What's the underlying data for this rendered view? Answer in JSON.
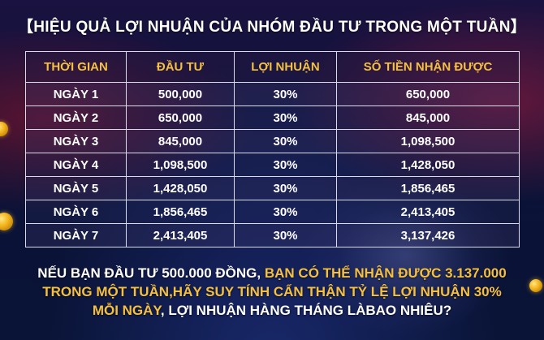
{
  "title": "【HIỆU QUẢ LỢI NHUẬN CỦA NHÓM ĐẦU TƯ TRONG MỘT TUẦN】",
  "table": {
    "headers": [
      "THỜI GIAN",
      "ĐẦU TƯ",
      "LỢI NHUẬN",
      "SỐ TIỀN NHẬN ĐƯỢC"
    ],
    "rows": [
      [
        "NGÀY 1",
        "500,000",
        "30%",
        "650,000"
      ],
      [
        "NGÀY 2",
        "650,000",
        "30%",
        "845,000"
      ],
      [
        "NGÀY 3",
        "845,000",
        "30%",
        "1,098,500"
      ],
      [
        "NGÀY 4",
        "1,098,500",
        "30%",
        "1,428,050"
      ],
      [
        "NGÀY 5",
        "1,428,050",
        "30%",
        "1,856,465"
      ],
      [
        "NGÀY 6",
        "1,856,465",
        "30%",
        "2,413,405"
      ],
      [
        "NGÀY 7",
        "2,413,405",
        "30%",
        "3,137,426"
      ]
    ]
  },
  "footer": {
    "line1_white": "NẾU BẠN ĐẦU TƯ 500.000 ĐỒNG, ",
    "line1_gold": "BẠN CÓ THỂ NHẬN ĐƯỢC 3.137.000",
    "line2_gold": "TRONG MỘT TUẦN,HÃY SUY TÍNH CẨN THẬN TỶ LỆ LỢI NHUẬN 30%",
    "line3_gold": "MỖI NGÀY",
    "line3_white": ", LỢI NHUẬN HÀNG THÁNG LÀBAO NHIÊU?"
  },
  "colors": {
    "header_text": "#f5c040",
    "highlight_text": "#f5c040",
    "body_text": "#ffffff",
    "background": "#0a1030"
  }
}
